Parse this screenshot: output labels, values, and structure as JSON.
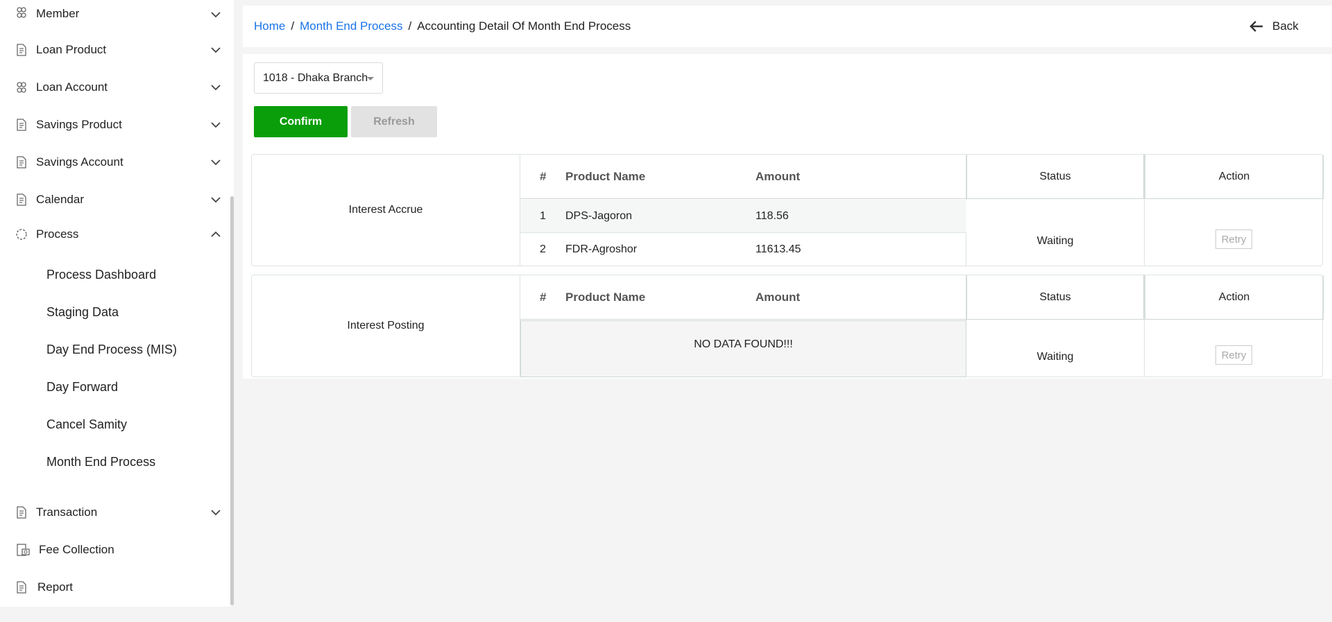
{
  "sidebar": {
    "items": [
      {
        "label": "Member",
        "icon": "people-icon",
        "expanded": false
      },
      {
        "label": "Loan Product",
        "icon": "document-icon",
        "expanded": false
      },
      {
        "label": "Loan Account",
        "icon": "people-icon",
        "expanded": false
      },
      {
        "label": "Savings Product",
        "icon": "document-icon",
        "expanded": false
      },
      {
        "label": "Savings Account",
        "icon": "document-icon",
        "expanded": false
      },
      {
        "label": "Calendar",
        "icon": "document-icon",
        "expanded": false
      },
      {
        "label": "Process",
        "icon": "loading-circle-icon",
        "expanded": true
      },
      {
        "label": "Transaction",
        "icon": "document-icon",
        "expanded": false
      },
      {
        "label": "Fee Collection",
        "icon": "fee-icon"
      },
      {
        "label": "Report",
        "icon": "document-icon"
      }
    ],
    "process_sub": [
      "Process Dashboard",
      "Staging Data",
      "Day End Process (MIS)",
      "Day Forward",
      "Cancel Samity",
      "Month End Process"
    ]
  },
  "header": {
    "breadcrumb": {
      "home": "Home",
      "parent": "Month End Process",
      "current": "Accounting Detail Of Month End Process",
      "sep": "/"
    },
    "back_label": "Back"
  },
  "main": {
    "branch": "1018 - Dhaka Branch",
    "confirm_label": "Confirm",
    "refresh_label": "Refresh",
    "columns": {
      "num": "#",
      "product": "Product Name",
      "amount": "Amount",
      "status": "Status",
      "action": "Action"
    },
    "blocks": [
      {
        "label": "Interest Accrue",
        "rows": [
          {
            "num": "1",
            "product": "DPS-Jagoron",
            "amount": "118.56"
          },
          {
            "num": "2",
            "product": "FDR-Agroshor",
            "amount": "11613.45"
          }
        ],
        "status": "Waiting",
        "action": "Retry"
      },
      {
        "label": "Interest Posting",
        "rows": [],
        "empty": "NO DATA FOUND!!!",
        "status": "Waiting",
        "action": "Retry"
      }
    ]
  }
}
